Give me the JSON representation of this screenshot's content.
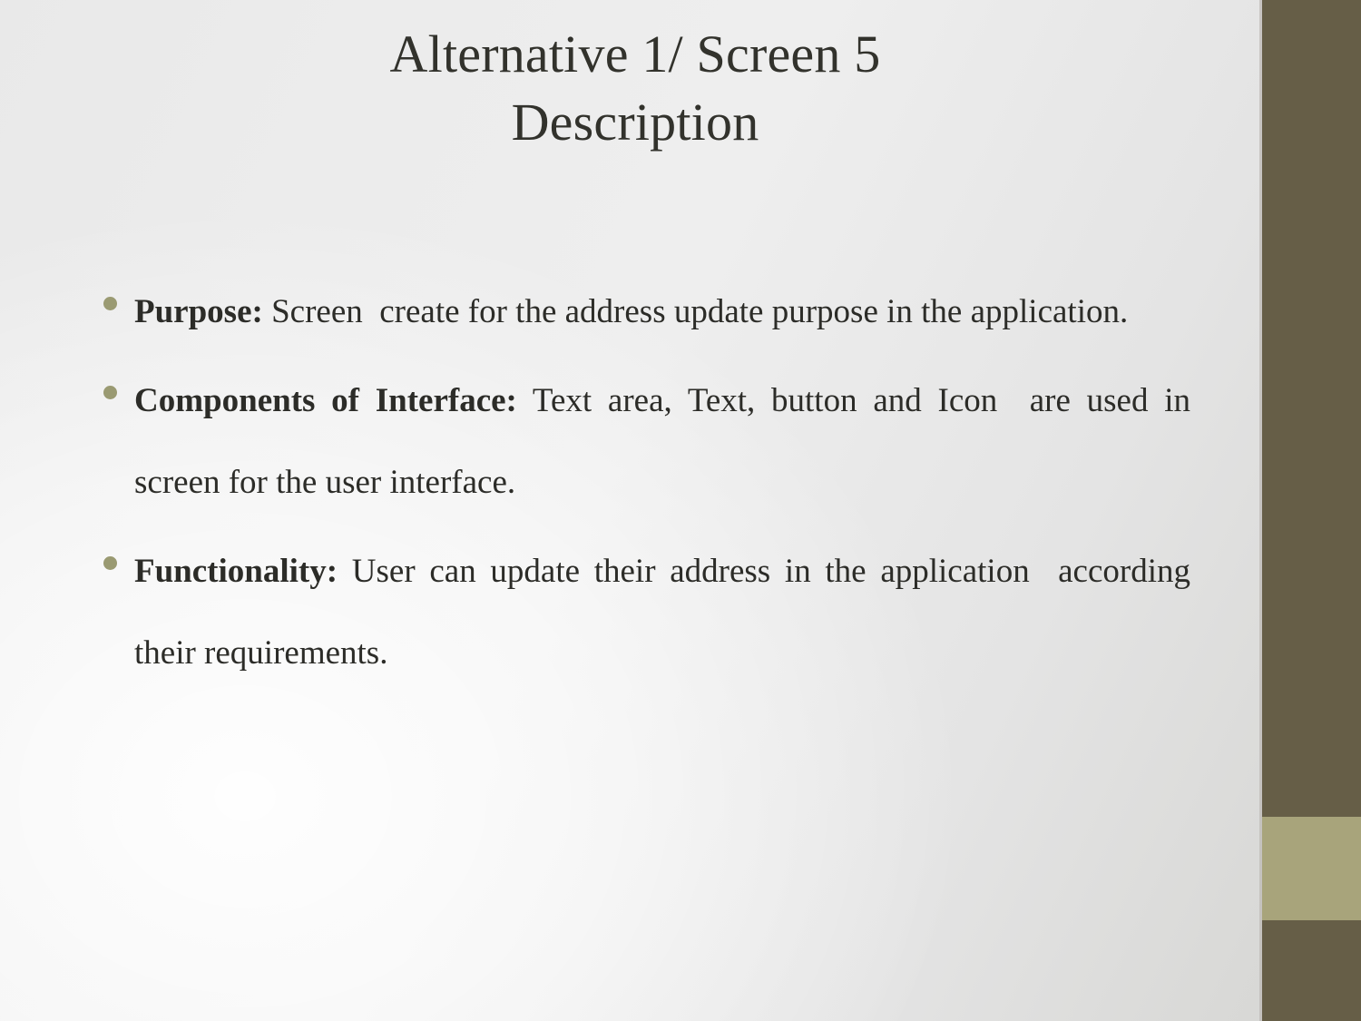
{
  "slide": {
    "title": {
      "line1": "Alternative 1/ Screen 5",
      "line2": "Description"
    },
    "bullets": [
      {
        "lead": "Purpose:",
        "text": " Screen  create for the address update purpose in the application."
      },
      {
        "lead": "Components of Interface:",
        "text": " Text area, Text, button and Icon  are used in screen for the user interface."
      },
      {
        "lead": "Functionality:",
        "text": " User can update their address in the application  according their requirements."
      }
    ],
    "decor": {
      "band_dark_color": "#665e47",
      "band_accent_color": "#a8a47b",
      "bullet_color": "#9a9a72",
      "text_color": "#2c2c28",
      "title_color": "#32322c"
    }
  }
}
